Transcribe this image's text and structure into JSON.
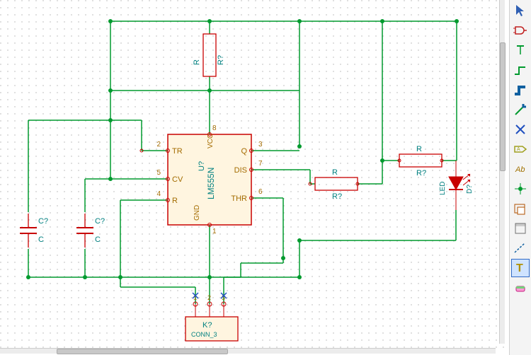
{
  "schematic": {
    "grid": {
      "spacing": 10,
      "dot_color": "#b0b0b0",
      "bg": "#ffffff"
    },
    "colors": {
      "wire": "#009a2e",
      "component_body": "#c80000",
      "component_fill": "#fff5e0",
      "pin_text": "#a36b00",
      "value_text": "#008080",
      "refdes_text": "#008080",
      "junction": "#009a2e"
    },
    "ic": {
      "ref": "U?",
      "value": "LM555N",
      "pins": {
        "TR": "2",
        "CV": "5",
        "R": "4",
        "Q": "3",
        "DIS": "7",
        "THR": "6",
        "VCC": "8",
        "GND": "1"
      }
    },
    "resistors": [
      {
        "ref": "R?",
        "value": "R",
        "orientation": "vertical",
        "id": "r_top"
      },
      {
        "ref": "R?",
        "value": "R",
        "orientation": "horizontal",
        "id": "r_dis"
      },
      {
        "ref": "R?",
        "value": "R",
        "orientation": "horizontal",
        "id": "r_led"
      }
    ],
    "capacitors": [
      {
        "ref": "C?",
        "value": "C",
        "id": "c_left"
      },
      {
        "ref": "C?",
        "value": "C",
        "id": "c_right"
      }
    ],
    "led": {
      "ref": "D?",
      "value": "LED"
    },
    "connector": {
      "ref": "K?",
      "value": "CONN_3",
      "pins": [
        "1",
        "2",
        "3"
      ]
    }
  },
  "toolbar": {
    "items": [
      {
        "id": "pointer",
        "glyph": "pointer",
        "color": "#2f5fb3"
      },
      {
        "id": "add-symbol",
        "glyph": "gate",
        "color": "#c02020"
      },
      {
        "id": "add-power",
        "glyph": "power",
        "color": "#009a2e"
      },
      {
        "id": "add-wire",
        "glyph": "wire",
        "color": "#009a2e"
      },
      {
        "id": "add-bus",
        "glyph": "bus",
        "color": "#1060a0"
      },
      {
        "id": "add-busentry",
        "glyph": "busentry",
        "color": "#009a2e"
      },
      {
        "id": "add-noconn",
        "glyph": "noconn",
        "color": "#2050c0"
      },
      {
        "id": "add-netlabel",
        "glyph": "netlabel",
        "color": "#a0a020"
      },
      {
        "id": "add-globallabel",
        "glyph": "globallabel",
        "color": "#a07000"
      },
      {
        "id": "add-junction",
        "glyph": "junction",
        "color": "#009a2e"
      },
      {
        "id": "add-hierlabel",
        "glyph": "hierlabel",
        "color": "#b05000"
      },
      {
        "id": "add-sheet",
        "glyph": "sheet",
        "color": "#707070"
      },
      {
        "id": "add-graphic-line",
        "glyph": "dashline",
        "color": "#1060a0"
      },
      {
        "id": "add-text",
        "glyph": "text",
        "color": "#b09000",
        "selected": true
      },
      {
        "id": "delete",
        "glyph": "eraser",
        "color": "#c02080"
      }
    ]
  }
}
